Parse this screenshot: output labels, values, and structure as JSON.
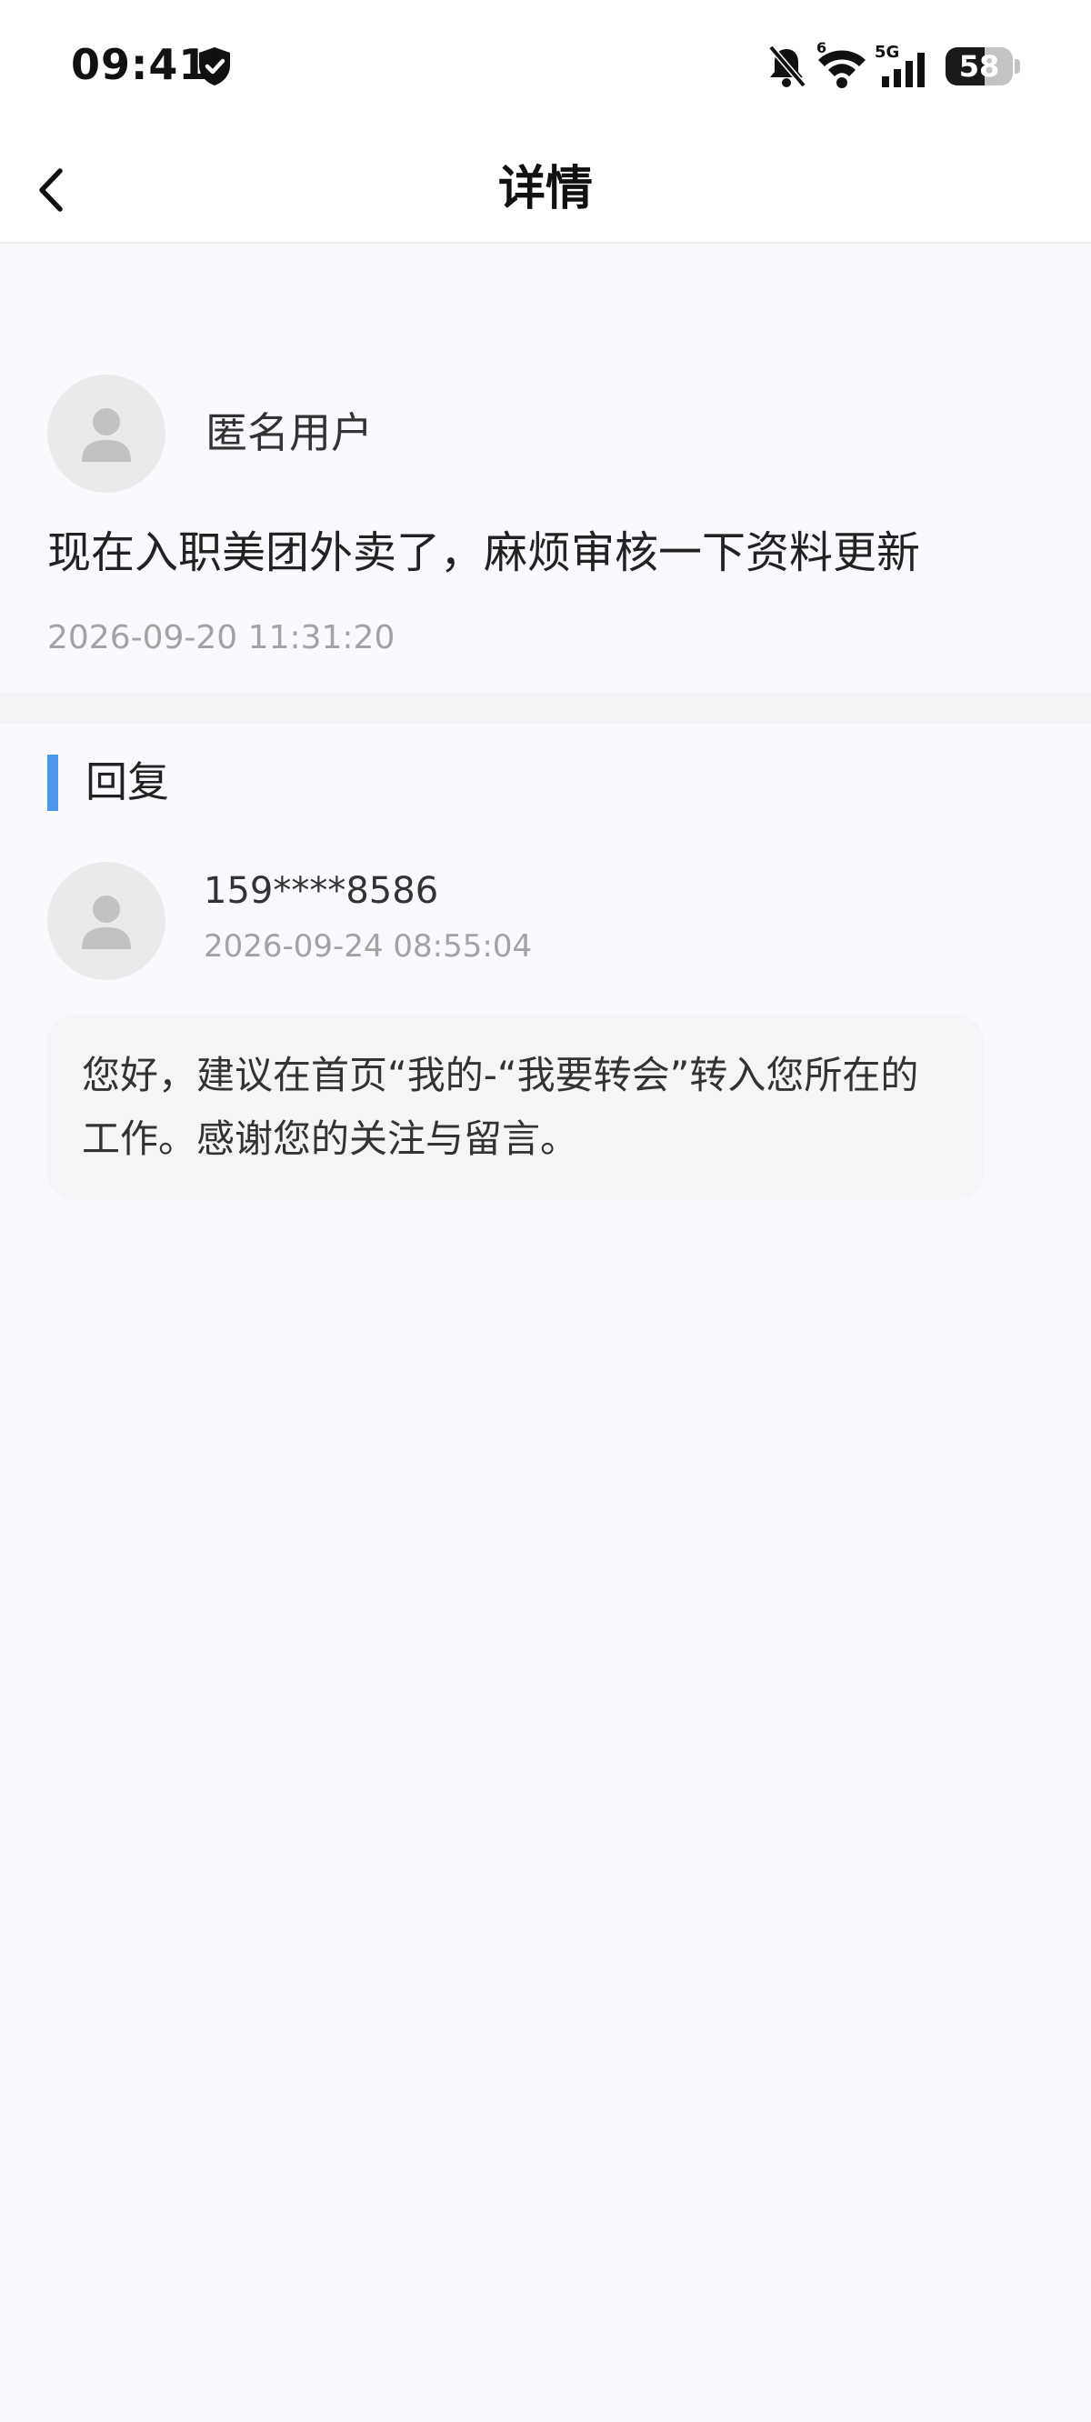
{
  "status_bar": {
    "time": "09:41",
    "network": "5G",
    "wifi_badge": "6",
    "battery_level": "58",
    "battery_percent": 58
  },
  "nav": {
    "title": "详情"
  },
  "question": {
    "user_name": "匿名用户",
    "content": "现在入职美团外卖了，麻烦审核一下资料更新",
    "timestamp": "2026-09-20 11:31:20"
  },
  "reply": {
    "section_title": "回复",
    "user_phone": "159****8586",
    "timestamp": "2026-09-24 08:55:04",
    "content": "您好，建议在首页“我的-“我要转会”转入您所在的工作。感谢您的关注与留言。"
  },
  "colors": {
    "accent": "#4c97ee",
    "background": "#f8fafd",
    "secondary_text": "#a3a3a3",
    "bubble": "#f4f5f7"
  },
  "icons": {
    "back": "chevron-left-icon",
    "shield": "shield-check-icon",
    "mute": "bell-off-icon",
    "wifi": "wifi-icon",
    "signal": "signal-bars-icon",
    "avatar": "person-placeholder-icon"
  }
}
